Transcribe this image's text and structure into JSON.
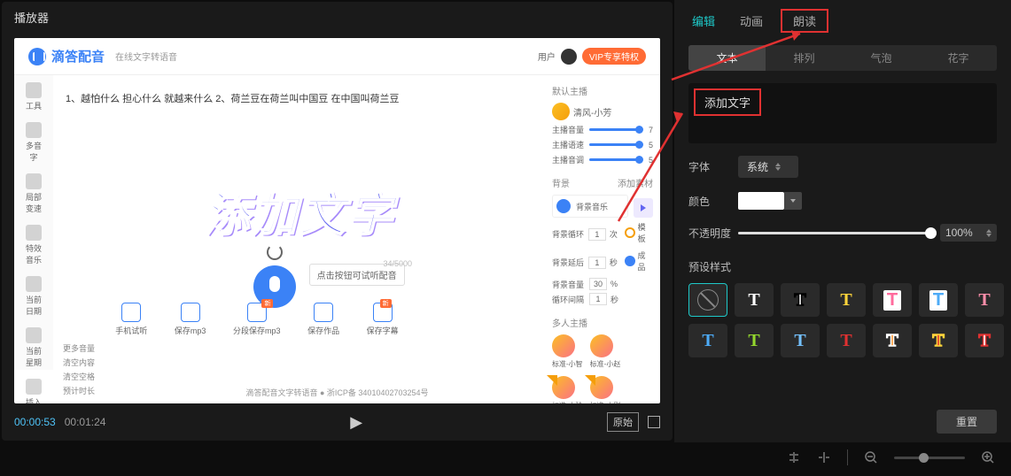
{
  "player": {
    "title": "播放器",
    "time_current": "00:00:53",
    "time_duration": "00:01:24",
    "ratio_label": "原始"
  },
  "preview": {
    "brand": "滴答配音",
    "brand_sub": "在线文字转语音",
    "top_user": "用户",
    "vip": "VIP专享特权",
    "side_items": [
      "工具",
      "多音字",
      "局部变速",
      "特效音乐",
      "当前日期",
      "当前星期",
      "插入停顿"
    ],
    "sentence": "1、越怕什么 担心什么 就越来什么   2、荷兰豆在荷兰叫中国豆 在中国叫荷兰豆",
    "big_text": "添加文字",
    "hint": "点击按钮可试听配音",
    "count": "34/5000",
    "r_sections": {
      "anchor_title": "默认主播",
      "anchor_name": "清风-小芳",
      "sliders": [
        {
          "label": "主播音量",
          "val": "7"
        },
        {
          "label": "主播语速",
          "val": "5"
        },
        {
          "label": "主播音调",
          "val": "5"
        }
      ],
      "bg_title": "背景",
      "bg_name": "背景音乐",
      "bg_rows": [
        {
          "label": "背景循环",
          "val": "1",
          "unit": "次"
        },
        {
          "label": "背景延后",
          "val": "1",
          "unit": "秒"
        },
        {
          "label": "背景音量",
          "val": "30",
          "unit": "%"
        },
        {
          "label": "循环间隔",
          "val": "1",
          "unit": "秒"
        }
      ],
      "video_title": "添加素材",
      "tags": [
        {
          "t": "模板"
        },
        {
          "t": "成品"
        }
      ],
      "multi_title": "多人主播",
      "multi": [
        "标准-小智",
        "标准-小赵",
        "标准-小玲",
        "标准-小刚"
      ]
    },
    "tools": [
      {
        "label": "手机试听",
        "badge": ""
      },
      {
        "label": "保存mp3",
        "badge": ""
      },
      {
        "label": "分段保存mp3",
        "badge": "新"
      },
      {
        "label": "保存作品",
        "badge": ""
      },
      {
        "label": "保存字幕",
        "badge": "新"
      }
    ],
    "left_menu": [
      "更多音量",
      "清空内容",
      "清空空格",
      "预计时长"
    ],
    "footer": "滴答配音文字转语音 ● 浙ICP备 34010402703254号"
  },
  "panel": {
    "tabs": [
      "编辑",
      "动画",
      "朗读"
    ],
    "subtabs": [
      "文本",
      "排列",
      "气泡",
      "花字"
    ],
    "textarea_placeholder": "添加文字",
    "font_label": "字体",
    "font_value": "系统",
    "color_label": "颜色",
    "opacity_label": "不透明度",
    "opacity_value": "100%",
    "preset_label": "预设样式",
    "reset": "重置"
  },
  "presets": [
    {
      "style": "none"
    },
    {
      "c": "#fff",
      "t": "T"
    },
    {
      "c": "#fff",
      "t": "T",
      "outline": "#000"
    },
    {
      "c": "#ffd43b",
      "t": "T"
    },
    {
      "c": "#ff6b9d",
      "t": "T",
      "bg": "#fff"
    },
    {
      "c": "#4dabf7",
      "t": "T",
      "bg": "#fff"
    },
    {
      "c": "#ff8fab",
      "t": "T"
    },
    {
      "c": "#4dabf7",
      "t": "T"
    },
    {
      "c": "#94d82d",
      "t": "T"
    },
    {
      "c": "#74c0fc",
      "t": "T"
    },
    {
      "c": "#e03131",
      "t": "T"
    },
    {
      "c": "#ff922b",
      "t": "T",
      "outline": "#fff"
    },
    {
      "c": "#e03131",
      "t": "T",
      "outline": "#ffd43b"
    },
    {
      "c": "#fff",
      "t": "T",
      "outline": "#e03131"
    }
  ]
}
